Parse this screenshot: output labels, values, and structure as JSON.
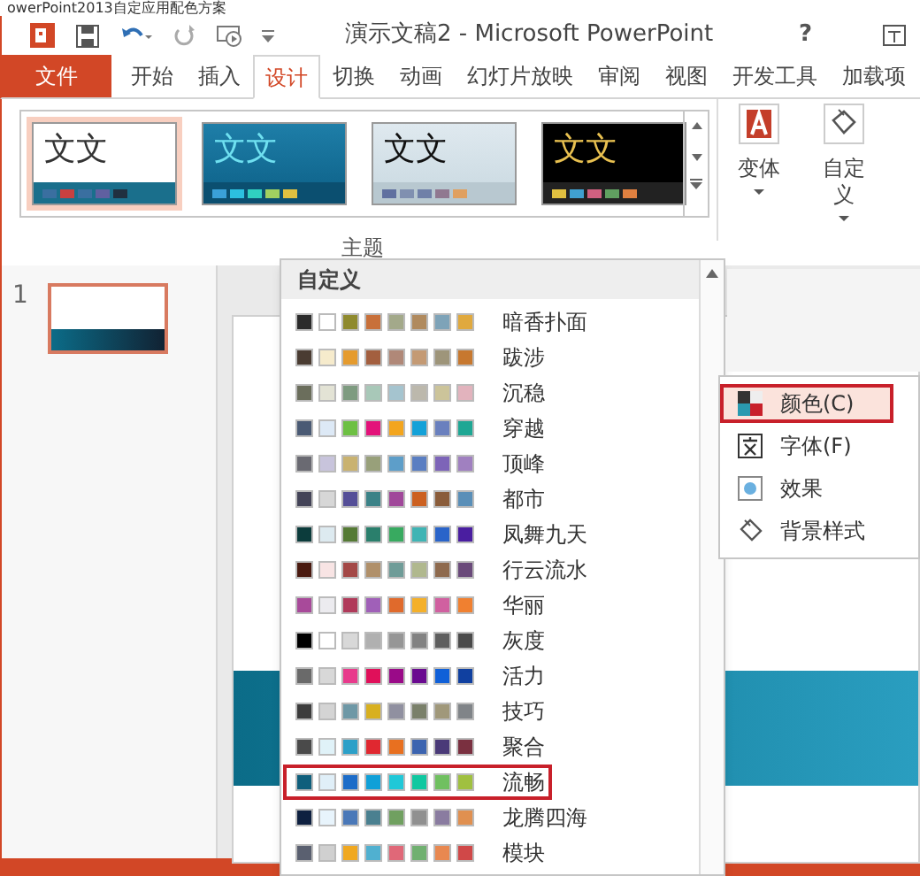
{
  "caption": "owerPoint2013自定应用配色方案",
  "title_bar": {
    "title": "演示文稿2 - Microsoft PowerPoint",
    "help": "?"
  },
  "tabs": [
    {
      "label": "文件",
      "kind": "file",
      "selected": false
    },
    {
      "label": "开始",
      "kind": "tab",
      "selected": false
    },
    {
      "label": "插入",
      "kind": "tab",
      "selected": false
    },
    {
      "label": "设计",
      "kind": "tab",
      "selected": true
    },
    {
      "label": "切换",
      "kind": "tab",
      "selected": false
    },
    {
      "label": "动画",
      "kind": "tab",
      "selected": false
    },
    {
      "label": "幻灯片放映",
      "kind": "tab",
      "selected": false
    },
    {
      "label": "审阅",
      "kind": "tab",
      "selected": false
    },
    {
      "label": "视图",
      "kind": "tab",
      "selected": false
    },
    {
      "label": "开发工具",
      "kind": "tab",
      "selected": false
    },
    {
      "label": "加载项",
      "kind": "tab",
      "selected": false
    }
  ],
  "themes": [
    {
      "sample": "文文",
      "kind": "white",
      "selected": true
    },
    {
      "sample": "文文",
      "kind": "blue",
      "selected": false
    },
    {
      "sample": "文文",
      "kind": "light",
      "selected": false
    },
    {
      "sample": "文文",
      "kind": "dark",
      "selected": false
    }
  ],
  "ribbon_buttons": [
    {
      "label": "变体",
      "kind": "variants"
    },
    {
      "label": "自定义",
      "kind": "customize"
    }
  ],
  "group_label": "主题",
  "slides": [
    {
      "number": "1",
      "selected": true
    }
  ],
  "color_menu": {
    "header": "自定义",
    "schemes": [
      {
        "name": "暗香扑面",
        "selected": false,
        "swatches": [
          {
            "color": "#2b2b2b"
          },
          {
            "color": "#ffffff"
          },
          {
            "color": "#8f8a2e"
          },
          {
            "color": "#c8703a"
          },
          {
            "color": "#a3a98a"
          },
          {
            "color": "#b08a5e"
          },
          {
            "color": "#7ea3b8"
          },
          {
            "color": "#e0a93e"
          }
        ]
      },
      {
        "name": "跋涉",
        "selected": false,
        "swatches": [
          {
            "color": "#4a3c32"
          },
          {
            "color": "#f6ebcc"
          },
          {
            "color": "#e59b2e"
          },
          {
            "color": "#a35f3f"
          },
          {
            "color": "#b08878"
          },
          {
            "color": "#c49a74"
          },
          {
            "color": "#9e957a"
          },
          {
            "color": "#c7782f"
          }
        ]
      },
      {
        "name": "沉稳",
        "selected": false,
        "swatches": [
          {
            "color": "#6b6e5c"
          },
          {
            "color": "#e3e3d5"
          },
          {
            "color": "#7e9b80"
          },
          {
            "color": "#a8c8b8"
          },
          {
            "color": "#a5c4cf"
          },
          {
            "color": "#bcb8ac"
          },
          {
            "color": "#ccc49a"
          },
          {
            "color": "#e2b3bd"
          }
        ]
      },
      {
        "name": "穿越",
        "selected": false,
        "swatches": [
          {
            "color": "#4a5a74"
          },
          {
            "color": "#dde9f6"
          },
          {
            "color": "#6dc043"
          },
          {
            "color": "#e3127a"
          },
          {
            "color": "#f3a51d"
          },
          {
            "color": "#13a1d8"
          },
          {
            "color": "#6a80be"
          },
          {
            "color": "#1ea794"
          }
        ]
      },
      {
        "name": "顶峰",
        "selected": false,
        "swatches": [
          {
            "color": "#6a6a72"
          },
          {
            "color": "#c8c4dc"
          },
          {
            "color": "#c9b270"
          },
          {
            "color": "#98a07a"
          },
          {
            "color": "#5d9ec9"
          },
          {
            "color": "#5a7ec2"
          },
          {
            "color": "#7d64b8"
          },
          {
            "color": "#a080c0"
          }
        ]
      },
      {
        "name": "都市",
        "selected": false,
        "swatches": [
          {
            "color": "#444458"
          },
          {
            "color": "#d7d7d7"
          },
          {
            "color": "#554f98"
          },
          {
            "color": "#3b8287"
          },
          {
            "color": "#a0489a"
          },
          {
            "color": "#cc6020"
          },
          {
            "color": "#8a5c3a"
          },
          {
            "color": "#5a8fb8"
          }
        ]
      },
      {
        "name": "凤舞九天",
        "selected": false,
        "swatches": [
          {
            "color": "#0c3c3c"
          },
          {
            "color": "#ddeaf0"
          },
          {
            "color": "#557a35"
          },
          {
            "color": "#2a7f6c"
          },
          {
            "color": "#38aa60"
          },
          {
            "color": "#3fb4b4"
          },
          {
            "color": "#2a64c9"
          },
          {
            "color": "#4a1ea0"
          }
        ]
      },
      {
        "name": "行云流水",
        "selected": false,
        "swatches": [
          {
            "color": "#4a1a10"
          },
          {
            "color": "#f8e4e4"
          },
          {
            "color": "#a34846"
          },
          {
            "color": "#b0906a"
          },
          {
            "color": "#6f9c98"
          },
          {
            "color": "#b0b88e"
          },
          {
            "color": "#8e6a4e"
          },
          {
            "color": "#6a4a7a"
          }
        ]
      },
      {
        "name": "华丽",
        "selected": false,
        "swatches": [
          {
            "color": "#a84a9a"
          },
          {
            "color": "#ecebef"
          },
          {
            "color": "#b03a5a"
          },
          {
            "color": "#a060b8"
          },
          {
            "color": "#e06a2c"
          },
          {
            "color": "#f4b02a"
          },
          {
            "color": "#d060a0"
          },
          {
            "color": "#f08030"
          }
        ]
      },
      {
        "name": "灰度",
        "selected": false,
        "swatches": [
          {
            "color": "#000000"
          },
          {
            "color": "#ffffff"
          },
          {
            "color": "#d8d8d8"
          },
          {
            "color": "#b0b0b0"
          },
          {
            "color": "#969696"
          },
          {
            "color": "#828282"
          },
          {
            "color": "#5e5e5e"
          },
          {
            "color": "#4a4a4a"
          }
        ]
      },
      {
        "name": "活力",
        "selected": false,
        "swatches": [
          {
            "color": "#6a6a6a"
          },
          {
            "color": "#d8d8d8"
          },
          {
            "color": "#e83a8c"
          },
          {
            "color": "#e0105a"
          },
          {
            "color": "#9a0a88"
          },
          {
            "color": "#6a0a90"
          },
          {
            "color": "#1060d8"
          },
          {
            "color": "#1040a0"
          }
        ]
      },
      {
        "name": "技巧",
        "selected": false,
        "swatches": [
          {
            "color": "#3c3c3c"
          },
          {
            "color": "#d4d4d4"
          },
          {
            "color": "#6e98a6"
          },
          {
            "color": "#d8b020"
          },
          {
            "color": "#9090a0"
          },
          {
            "color": "#7a806a"
          },
          {
            "color": "#a0987a"
          },
          {
            "color": "#808488"
          }
        ]
      },
      {
        "name": "聚合",
        "selected": false,
        "swatches": [
          {
            "color": "#4a4a4a"
          },
          {
            "color": "#e0f2f8"
          },
          {
            "color": "#2ca0c8"
          },
          {
            "color": "#e02830"
          },
          {
            "color": "#e87020"
          },
          {
            "color": "#3c64b0"
          },
          {
            "color": "#4a3a78"
          },
          {
            "color": "#7a3040"
          }
        ]
      },
      {
        "name": "流畅",
        "selected": true,
        "swatches": [
          {
            "color": "#0f5f7c"
          },
          {
            "color": "#e0eff8"
          },
          {
            "color": "#1c6cc8"
          },
          {
            "color": "#10a0d8"
          },
          {
            "color": "#20c8d8"
          },
          {
            "color": "#10c8a0"
          },
          {
            "color": "#70c060"
          },
          {
            "color": "#a0c040"
          }
        ]
      },
      {
        "name": "龙腾四海",
        "selected": false,
        "swatches": [
          {
            "color": "#0e2040"
          },
          {
            "color": "#e8f4fc"
          },
          {
            "color": "#4a78b8"
          },
          {
            "color": "#4a8090"
          },
          {
            "color": "#70a060"
          },
          {
            "color": "#909090"
          },
          {
            "color": "#8a7ca0"
          },
          {
            "color": "#e09050"
          }
        ]
      },
      {
        "name": "模块",
        "selected": false,
        "swatches": [
          {
            "color": "#5a6070"
          },
          {
            "color": "#d0d0d0"
          },
          {
            "color": "#f0a820"
          },
          {
            "color": "#50b0d0"
          },
          {
            "color": "#e06878"
          },
          {
            "color": "#70b070"
          },
          {
            "color": "#e88850"
          },
          {
            "color": "#d04848"
          }
        ]
      }
    ]
  },
  "submenu": [
    {
      "label": "颜色(C)",
      "kind": "colors",
      "selected": true
    },
    {
      "label": "字体(F)",
      "kind": "fonts",
      "selected": false
    },
    {
      "label": "效果",
      "kind": "effects",
      "selected": false
    },
    {
      "label": "背景样式",
      "kind": "background",
      "selected": false
    }
  ]
}
